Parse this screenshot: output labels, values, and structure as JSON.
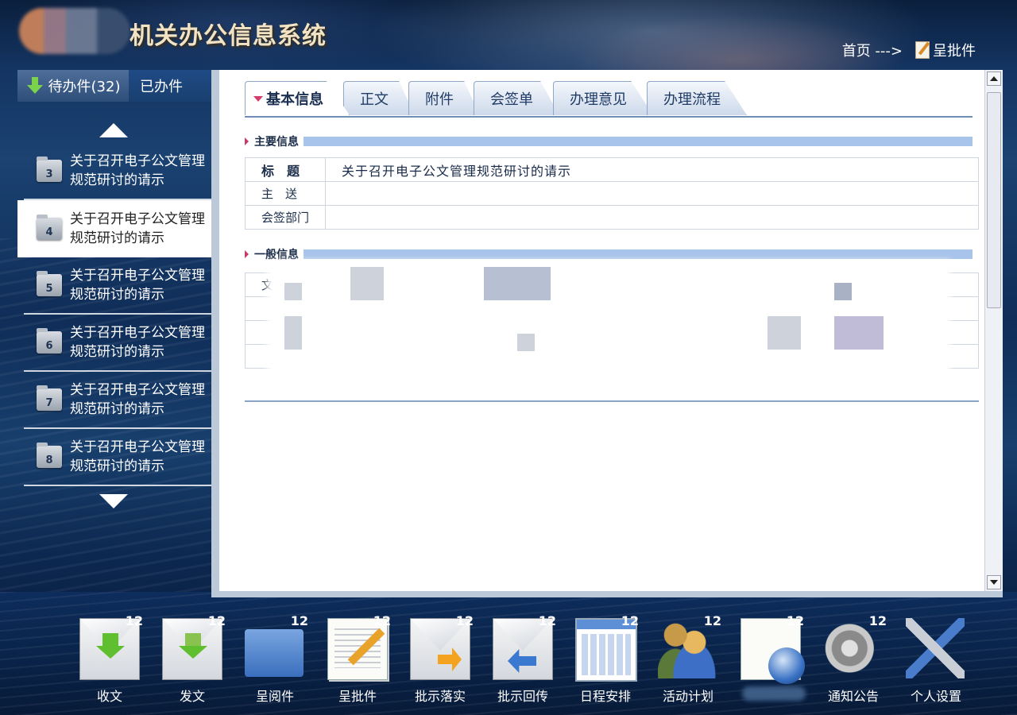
{
  "header": {
    "app_title": "机关办公信息系统",
    "nav_home": "首页 --->",
    "nav_current": "呈批件"
  },
  "left_panel": {
    "tab_todo": "待办件(32)",
    "tab_done": "已办件",
    "items": [
      {
        "number": "3",
        "title": "关于召开电子公文管理规范研讨的请示",
        "active": false
      },
      {
        "number": "4",
        "title": "关于召开电子公文管理规范研讨的请示",
        "active": true
      },
      {
        "number": "5",
        "title": "关于召开电子公文管理规范研讨的请示",
        "active": false
      },
      {
        "number": "6",
        "title": "关于召开电子公文管理规范研讨的请示",
        "active": false
      },
      {
        "number": "7",
        "title": "关于召开电子公文管理规范研讨的请示",
        "active": false
      },
      {
        "number": "8",
        "title": "关于召开电子公文管理规范研讨的请示",
        "active": false
      }
    ]
  },
  "main": {
    "tabs": [
      "基本信息",
      "正文",
      "附件",
      "会签单",
      "办理意见",
      "办理流程"
    ],
    "section_main": "主要信息",
    "section_general": "一般信息",
    "fields": {
      "title_label": "标　题",
      "title_value": "关于召开电子公文管理规范研讨的请示",
      "send_label": "主　送",
      "send_value": "",
      "dept_label": "会签部门",
      "dept_value": "",
      "doctype_label": "文件类型"
    }
  },
  "dock": [
    {
      "label": "收文",
      "badge": "12",
      "icon": "inbox-mail-icon"
    },
    {
      "label": "发文",
      "badge": "12",
      "icon": "send-mail-icon"
    },
    {
      "label": "呈阅件",
      "badge": "12",
      "icon": "folder-icon"
    },
    {
      "label": "呈批件",
      "badge": "12",
      "icon": "pencil-document-icon"
    },
    {
      "label": "批示落实",
      "badge": "12",
      "icon": "forward-mail-icon"
    },
    {
      "label": "批示回传",
      "badge": "12",
      "icon": "reply-mail-icon"
    },
    {
      "label": "日程安排",
      "badge": "12",
      "icon": "calendar-icon"
    },
    {
      "label": "活动计划",
      "badge": "12",
      "icon": "people-icon"
    },
    {
      "label": "",
      "badge": "12",
      "icon": "globe-document-icon"
    },
    {
      "label": "通知公告",
      "badge": "12",
      "icon": "speaker-icon"
    },
    {
      "label": "个人设置",
      "badge": "",
      "icon": "tools-icon"
    }
  ],
  "colors": {
    "accent_blue": "#a8c4ea",
    "tab_marker": "#d33c6b",
    "title_text": "#f2e3c4"
  }
}
